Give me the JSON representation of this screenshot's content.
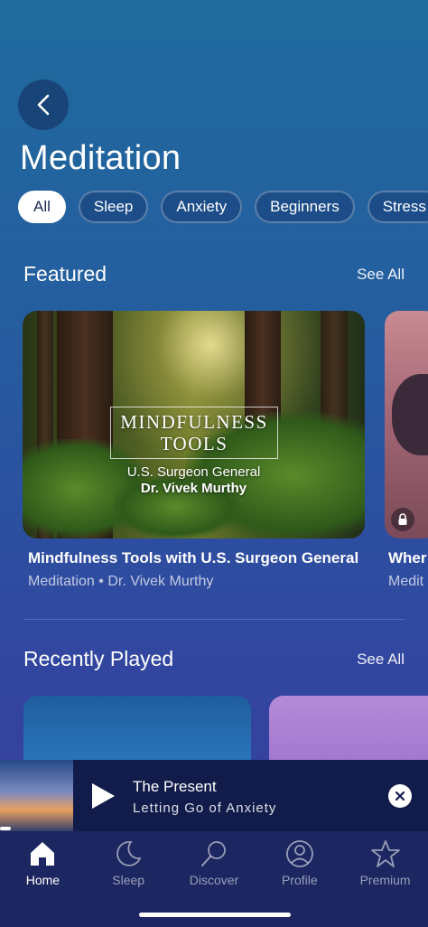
{
  "header": {
    "title": "Meditation",
    "back_icon": "chevron-left-icon"
  },
  "filters": [
    {
      "label": "All",
      "active": true
    },
    {
      "label": "Sleep",
      "active": false
    },
    {
      "label": "Anxiety",
      "active": false
    },
    {
      "label": "Beginners",
      "active": false
    },
    {
      "label": "Stress",
      "active": false
    }
  ],
  "featured": {
    "title": "Featured",
    "see_all": "See All",
    "cards": [
      {
        "art_line1": "MINDFULNESS",
        "art_line2": "TOOLS",
        "art_sub1": "U.S. Surgeon General",
        "art_sub2": "Dr. Vivek Murthy",
        "title": "Mindfulness Tools with U.S. Surgeon General",
        "meta": "Meditation • Dr. Vivek Murthy",
        "locked": false
      },
      {
        "title": "Wher",
        "meta": "Medit",
        "locked": true
      }
    ]
  },
  "recently_played": {
    "title": "Recently Played",
    "see_all": "See All"
  },
  "mini_player": {
    "title": "The Present",
    "subtitle": "Letting Go of Anxiety",
    "progress": 0.025
  },
  "tabs": [
    {
      "label": "Home",
      "icon": "home-icon",
      "active": true
    },
    {
      "label": "Sleep",
      "icon": "moon-icon",
      "active": false
    },
    {
      "label": "Discover",
      "icon": "search-icon",
      "active": false
    },
    {
      "label": "Profile",
      "icon": "profile-icon",
      "active": false
    },
    {
      "label": "Premium",
      "icon": "star-icon",
      "active": false
    }
  ],
  "colors": {
    "accent": "#ffffff",
    "tab_bar": "#1c2660",
    "mini_player": "#111c4a"
  }
}
